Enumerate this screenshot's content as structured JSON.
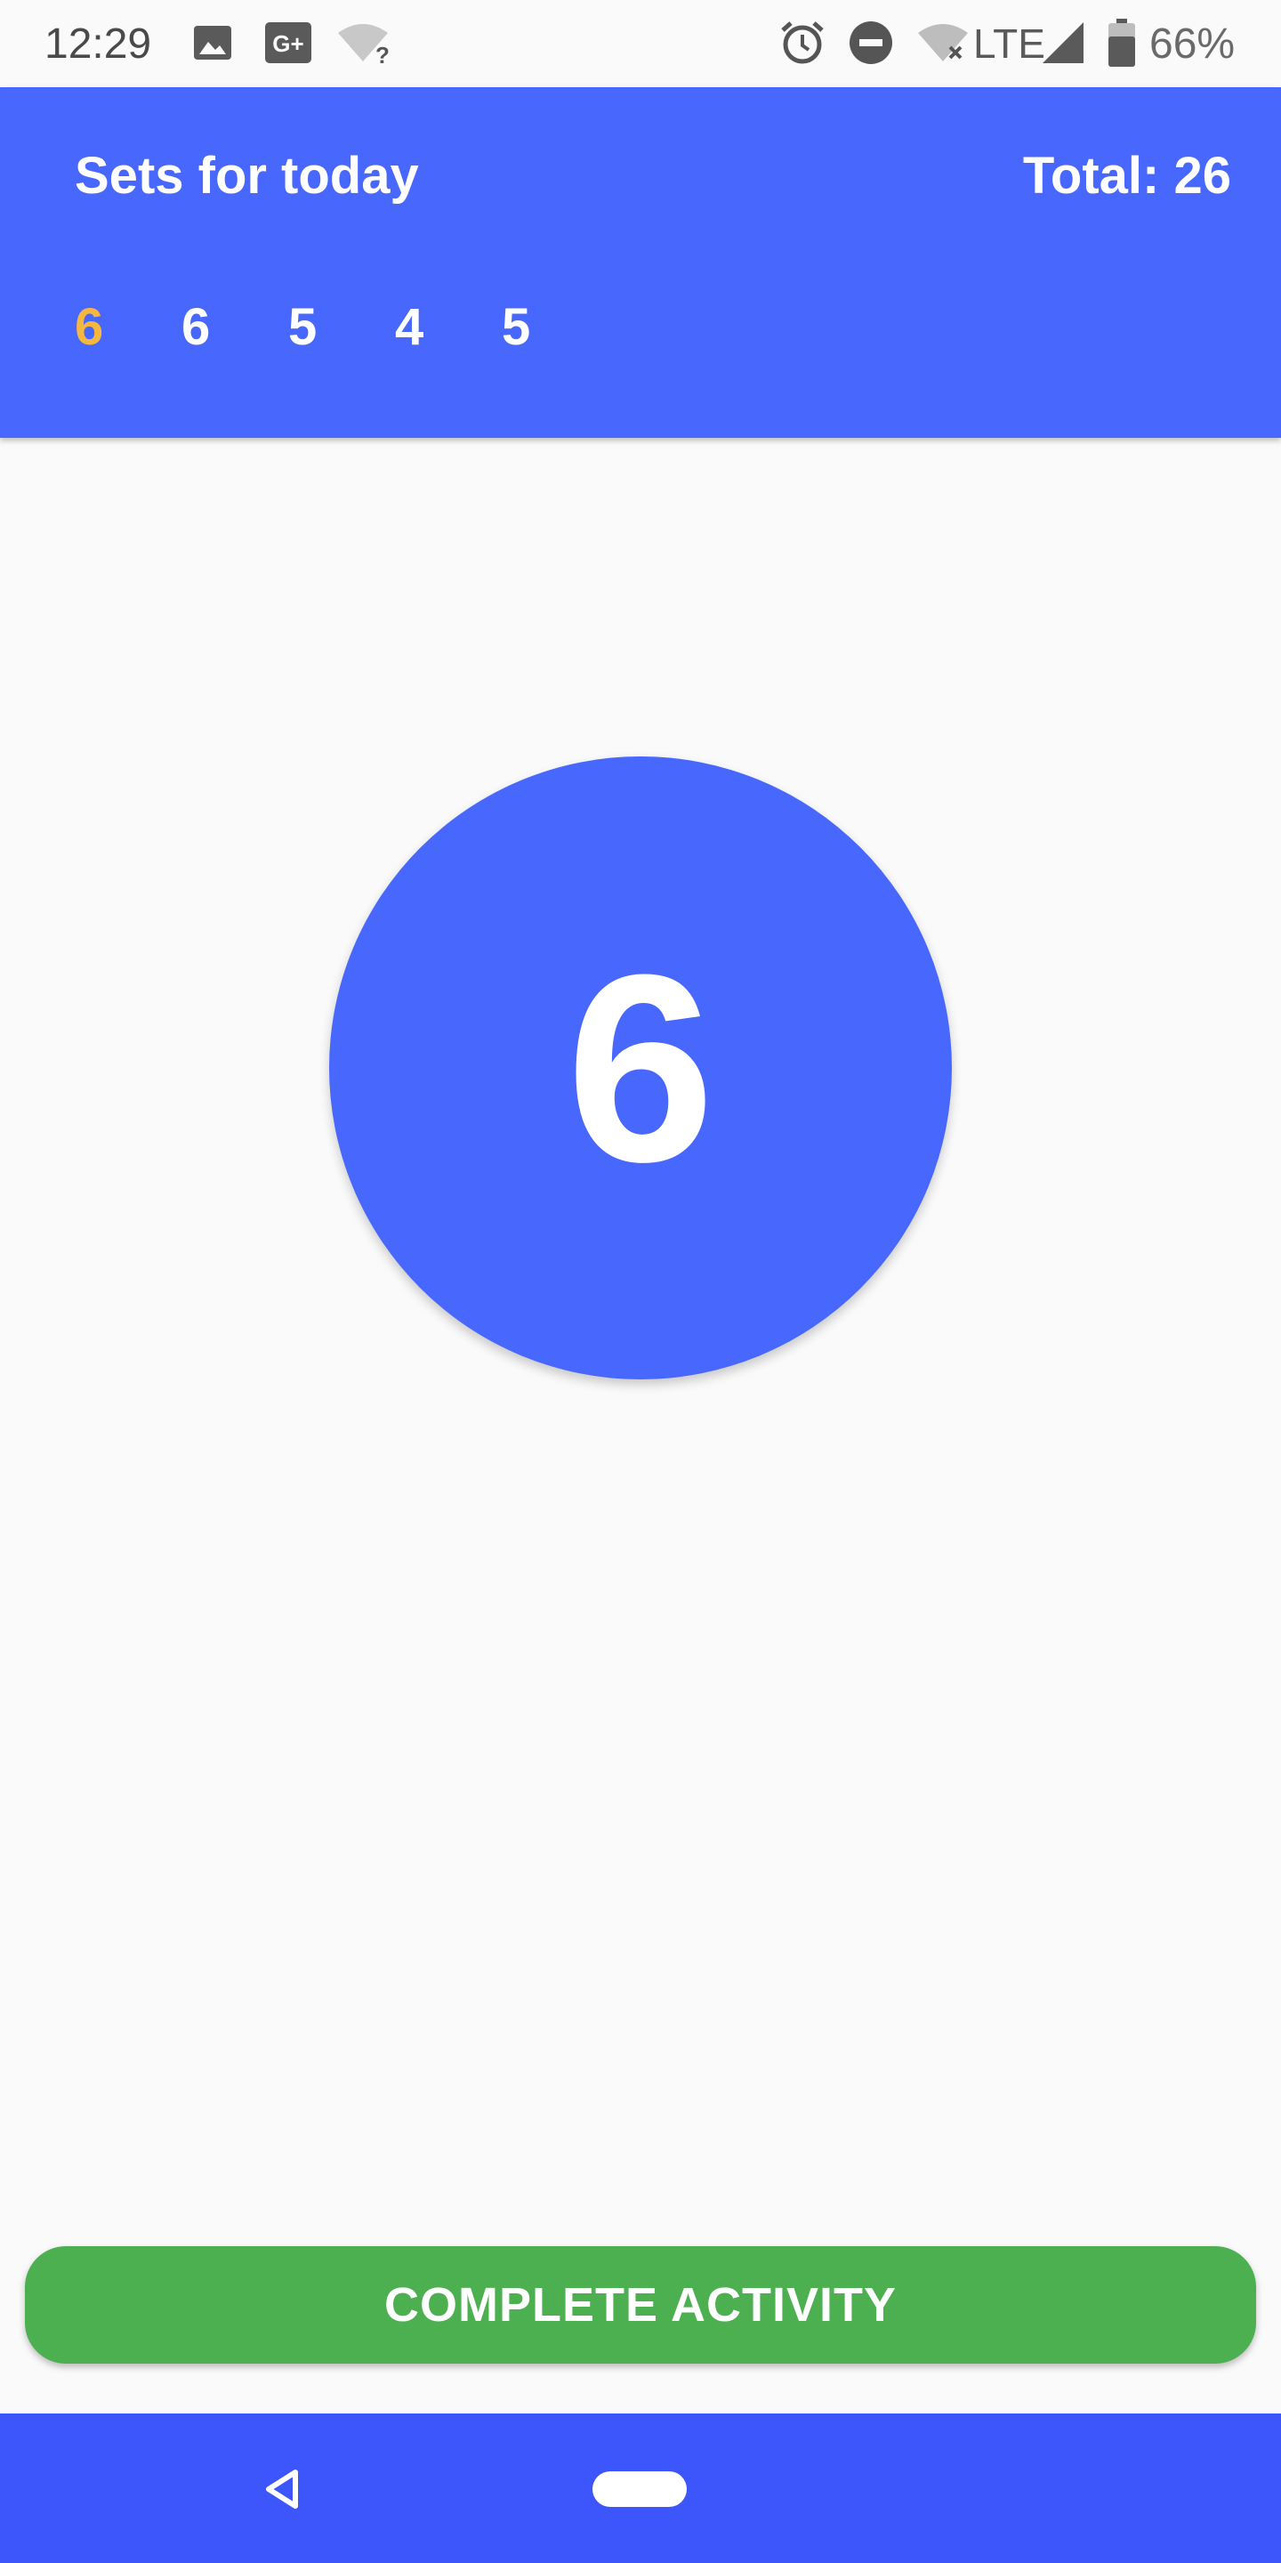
{
  "status_bar": {
    "time": "12:29",
    "network": "LTE",
    "battery": "66%",
    "icons": [
      "image-icon",
      "google-plus-icon",
      "wifi-unknown-icon",
      "alarm-icon",
      "do-not-disturb-icon",
      "wifi-off-icon",
      "signal-icon",
      "battery-icon"
    ]
  },
  "header": {
    "title": "Sets for today",
    "total": "Total: 26",
    "sets": [
      "6",
      "6",
      "5",
      "4",
      "5"
    ],
    "active_index": 0
  },
  "counter": {
    "value": "6"
  },
  "actions": {
    "complete_label": "COMPLETE ACTIVITY"
  },
  "navbar": {
    "icons": [
      "back-icon",
      "home-icon"
    ]
  },
  "colors": {
    "primary": "#4767fd",
    "active_set": "#f6b740",
    "button": "#4caf50",
    "navbar": "#3d56fb"
  }
}
